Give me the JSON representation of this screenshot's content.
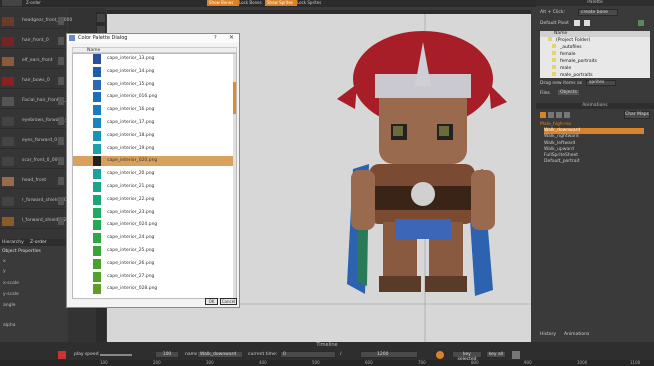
{
  "toolbar": {
    "items": [
      "Z-order",
      "Show Bones",
      "Lock Bones",
      "Show Sprites",
      "Lock Sprites"
    ],
    "colors": {
      "bar": "#2b2b2b",
      "accent": "#d8822a"
    }
  },
  "layers": [
    {
      "label": "headgear_front_0_000",
      "color": "#6b3a2a"
    },
    {
      "label": "hair_front_0",
      "color": "#7a2222"
    },
    {
      "label": "elf_ears_front",
      "color": "#8b5a3a"
    },
    {
      "label": "hair_bows_0",
      "color": "#8b2020"
    },
    {
      "label": "Facial_hair_front_0_000",
      "color": "#555"
    },
    {
      "label": "eyebrows_forward_0",
      "color": "#444"
    },
    {
      "label": "eyes_forward_0",
      "color": "#444"
    },
    {
      "label": "scar_front_0_000",
      "color": "#444"
    },
    {
      "label": "head_front",
      "color": "#9a6a4a"
    },
    {
      "label": "r_forward_shield0_0",
      "color": "#444"
    },
    {
      "label": "l_forward_shield0_2",
      "color": "#8a5a2a"
    }
  ],
  "left_tabs": {
    "hierarchy": "Hierarchy",
    "zorder": "Z-order"
  },
  "object_properties": {
    "title": "Object Properties",
    "fields": [
      "x",
      "y",
      "x-scale",
      "y-scale",
      "angle",
      "alpha"
    ]
  },
  "dialog": {
    "title": "Color Palette Dialog",
    "help": "?",
    "close": "✕",
    "header": "Name",
    "items": [
      {
        "name": "cape_interior_13.png",
        "color": "#2a4f9c"
      },
      {
        "name": "cape_interior_14.png",
        "color": "#1f5fa8"
      },
      {
        "name": "cape_interior_15.png",
        "color": "#2a6ab2"
      },
      {
        "name": "cape_interior_016.png",
        "color": "#1d6ec0"
      },
      {
        "name": "cape_interior_16.png",
        "color": "#1a7ac4"
      },
      {
        "name": "cape_interior_17.png",
        "color": "#1985c0"
      },
      {
        "name": "cape_interior_18.png",
        "color": "#1b93b8"
      },
      {
        "name": "cape_interior_19.png",
        "color": "#1ca0ae"
      },
      {
        "name": "cape_interior_020.png",
        "color": "#222"
      },
      {
        "name": "cape_interior_20.png",
        "color": "#1aa39c"
      },
      {
        "name": "cape_interior_21.png",
        "color": "#1aa68a"
      },
      {
        "name": "cape_interior_22.png",
        "color": "#1ba877"
      },
      {
        "name": "cape_interior_23.png",
        "color": "#1daa63"
      },
      {
        "name": "cape_interior_024.png",
        "color": "#22aa4f"
      },
      {
        "name": "cape_interior_24.png",
        "color": "#2ea744"
      },
      {
        "name": "cape_interior_25.png",
        "color": "#3aa43a"
      },
      {
        "name": "cape_interior_26.png",
        "color": "#48a232"
      },
      {
        "name": "cape_interior_27.png",
        "color": "#54a02d"
      },
      {
        "name": "cape_interior_028.png",
        "color": "#5d9d2a"
      }
    ],
    "selected_index": 8,
    "ok": "OK",
    "cancel": "Cancel"
  },
  "right": {
    "palette_title": "Palette",
    "alt_click": "Alt + Click:",
    "clone_bone": "create bone",
    "default_pivot": "Default Pivot",
    "tree_header": "Name",
    "tree": [
      "(Project Folder)",
      "_autofiles",
      "female",
      "female_portraits",
      "male",
      "male_portraits"
    ],
    "drop_label": "Drag new items as",
    "drop_value": "sprites",
    "tabs": [
      "Files",
      "Objects"
    ],
    "animations_title": "Animations",
    "anim_items": [
      {
        "label": "Male_high-res",
        "selected": false
      },
      {
        "label": "Walk_downward",
        "selected": true
      },
      {
        "label": "Walk_rightward",
        "selected": false
      },
      {
        "label": "Walk_leftward",
        "selected": false
      },
      {
        "label": "Walk_upward",
        "selected": false
      },
      {
        "label": "FullSpriteSheet",
        "selected": false
      },
      {
        "label": "Default_portrait",
        "selected": false
      }
    ],
    "char_maps": "Char Maps",
    "bottom_tabs": [
      "History",
      "Animations"
    ]
  },
  "timeline": {
    "title": "Timeline",
    "play_speed": "play speed",
    "frame_value": "100",
    "name_label": "name",
    "name_value": "Walk_downward",
    "current_time_label": "current time:",
    "current_time": "0",
    "length": "1200",
    "key_selected": "key selected",
    "key_all": "key all",
    "ticks": [
      "100",
      "200",
      "300",
      "400",
      "500",
      "600",
      "700",
      "800",
      "900",
      "1000",
      "1100"
    ]
  }
}
